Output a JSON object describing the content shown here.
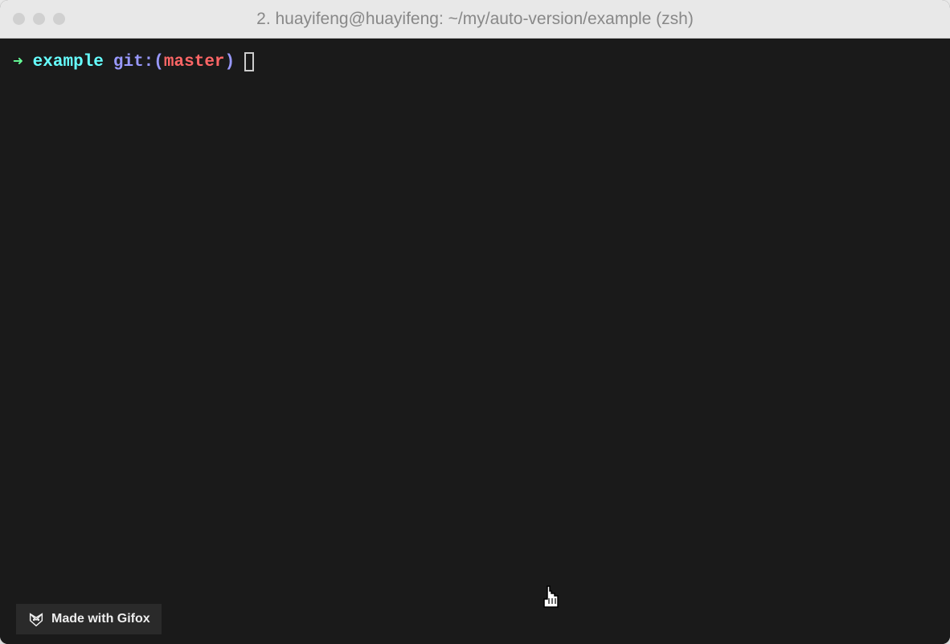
{
  "window": {
    "title": "2. huayifeng@huayifeng: ~/my/auto-version/example (zsh)"
  },
  "prompt": {
    "arrow": "➜",
    "directory": "example",
    "git_label": "git:",
    "paren_open": "(",
    "branch": "master",
    "paren_close": ")"
  },
  "watermark": {
    "prefix": "Made with ",
    "brand": "Gifox"
  }
}
